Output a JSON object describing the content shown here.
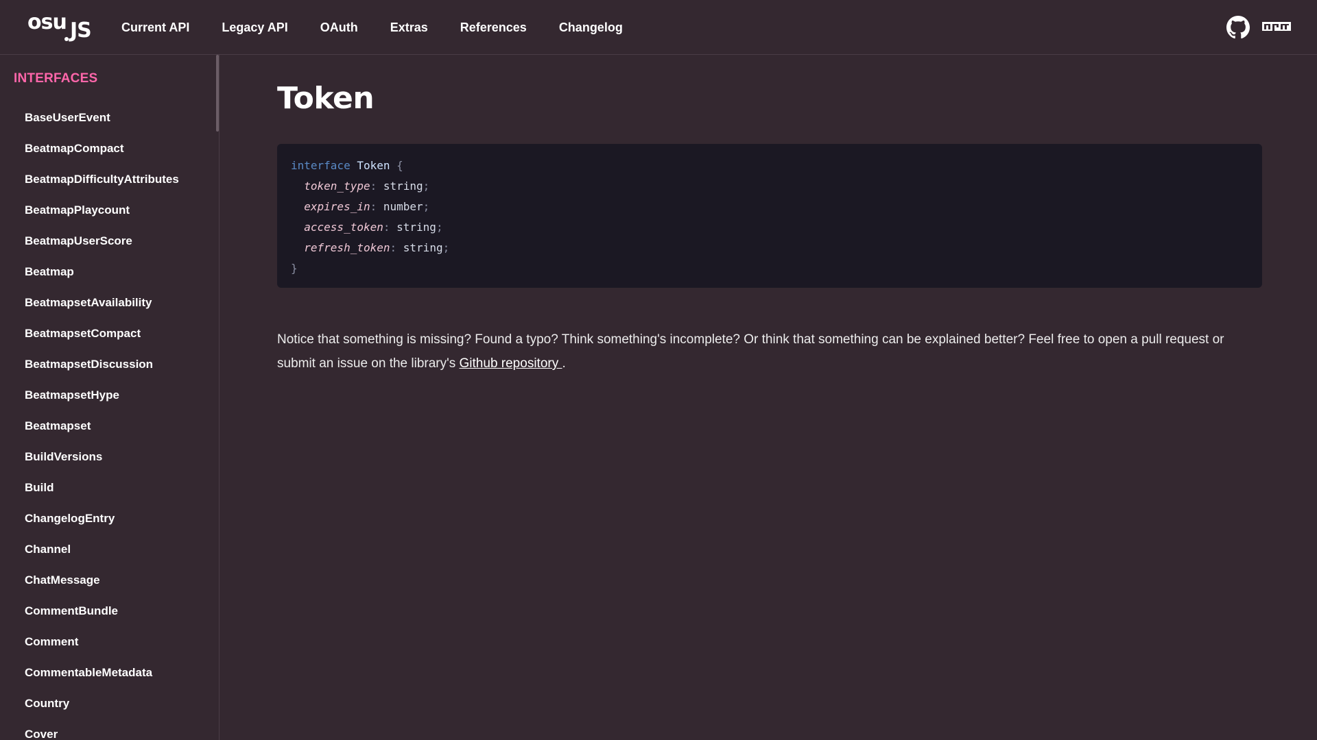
{
  "logo": {
    "part1": "osu",
    "part2": "JS"
  },
  "nav": {
    "items": [
      {
        "label": "Current API"
      },
      {
        "label": "Legacy API"
      },
      {
        "label": "OAuth"
      },
      {
        "label": "Extras"
      },
      {
        "label": "References"
      },
      {
        "label": "Changelog"
      }
    ],
    "icons": [
      "github-icon",
      "npm-icon"
    ]
  },
  "sidebar": {
    "heading": "INTERFACES",
    "items": [
      {
        "label": "BaseUserEvent"
      },
      {
        "label": "BeatmapCompact"
      },
      {
        "label": "BeatmapDifficultyAttributes"
      },
      {
        "label": "BeatmapPlaycount"
      },
      {
        "label": "BeatmapUserScore"
      },
      {
        "label": "Beatmap"
      },
      {
        "label": "BeatmapsetAvailability"
      },
      {
        "label": "BeatmapsetCompact"
      },
      {
        "label": "BeatmapsetDiscussion"
      },
      {
        "label": "BeatmapsetHype"
      },
      {
        "label": "Beatmapset"
      },
      {
        "label": "BuildVersions"
      },
      {
        "label": "Build"
      },
      {
        "label": "ChangelogEntry"
      },
      {
        "label": "Channel"
      },
      {
        "label": "ChatMessage"
      },
      {
        "label": "CommentBundle"
      },
      {
        "label": "Comment"
      },
      {
        "label": "CommentableMetadata"
      },
      {
        "label": "Country"
      },
      {
        "label": "Cover"
      }
    ]
  },
  "main": {
    "title": "Token",
    "code": {
      "keyword": "interface",
      "name": "Token",
      "open": "{",
      "close": "}",
      "fields": [
        {
          "name": "token_type",
          "type": "string"
        },
        {
          "name": "expires_in",
          "type": "number"
        },
        {
          "name": "access_token",
          "type": "string"
        },
        {
          "name": "refresh_token",
          "type": "string"
        }
      ]
    },
    "notice": {
      "text": "Notice that something is missing? Found a typo? Think something's incomplete? Or think that something can be explained better? Feel free to open a pull request or submit an issue on the library's ",
      "link": "Github repository ",
      "end": "."
    }
  },
  "colors": {
    "background": "#342830",
    "accent": "#ff66aa",
    "code_bg": "#1b1823"
  }
}
